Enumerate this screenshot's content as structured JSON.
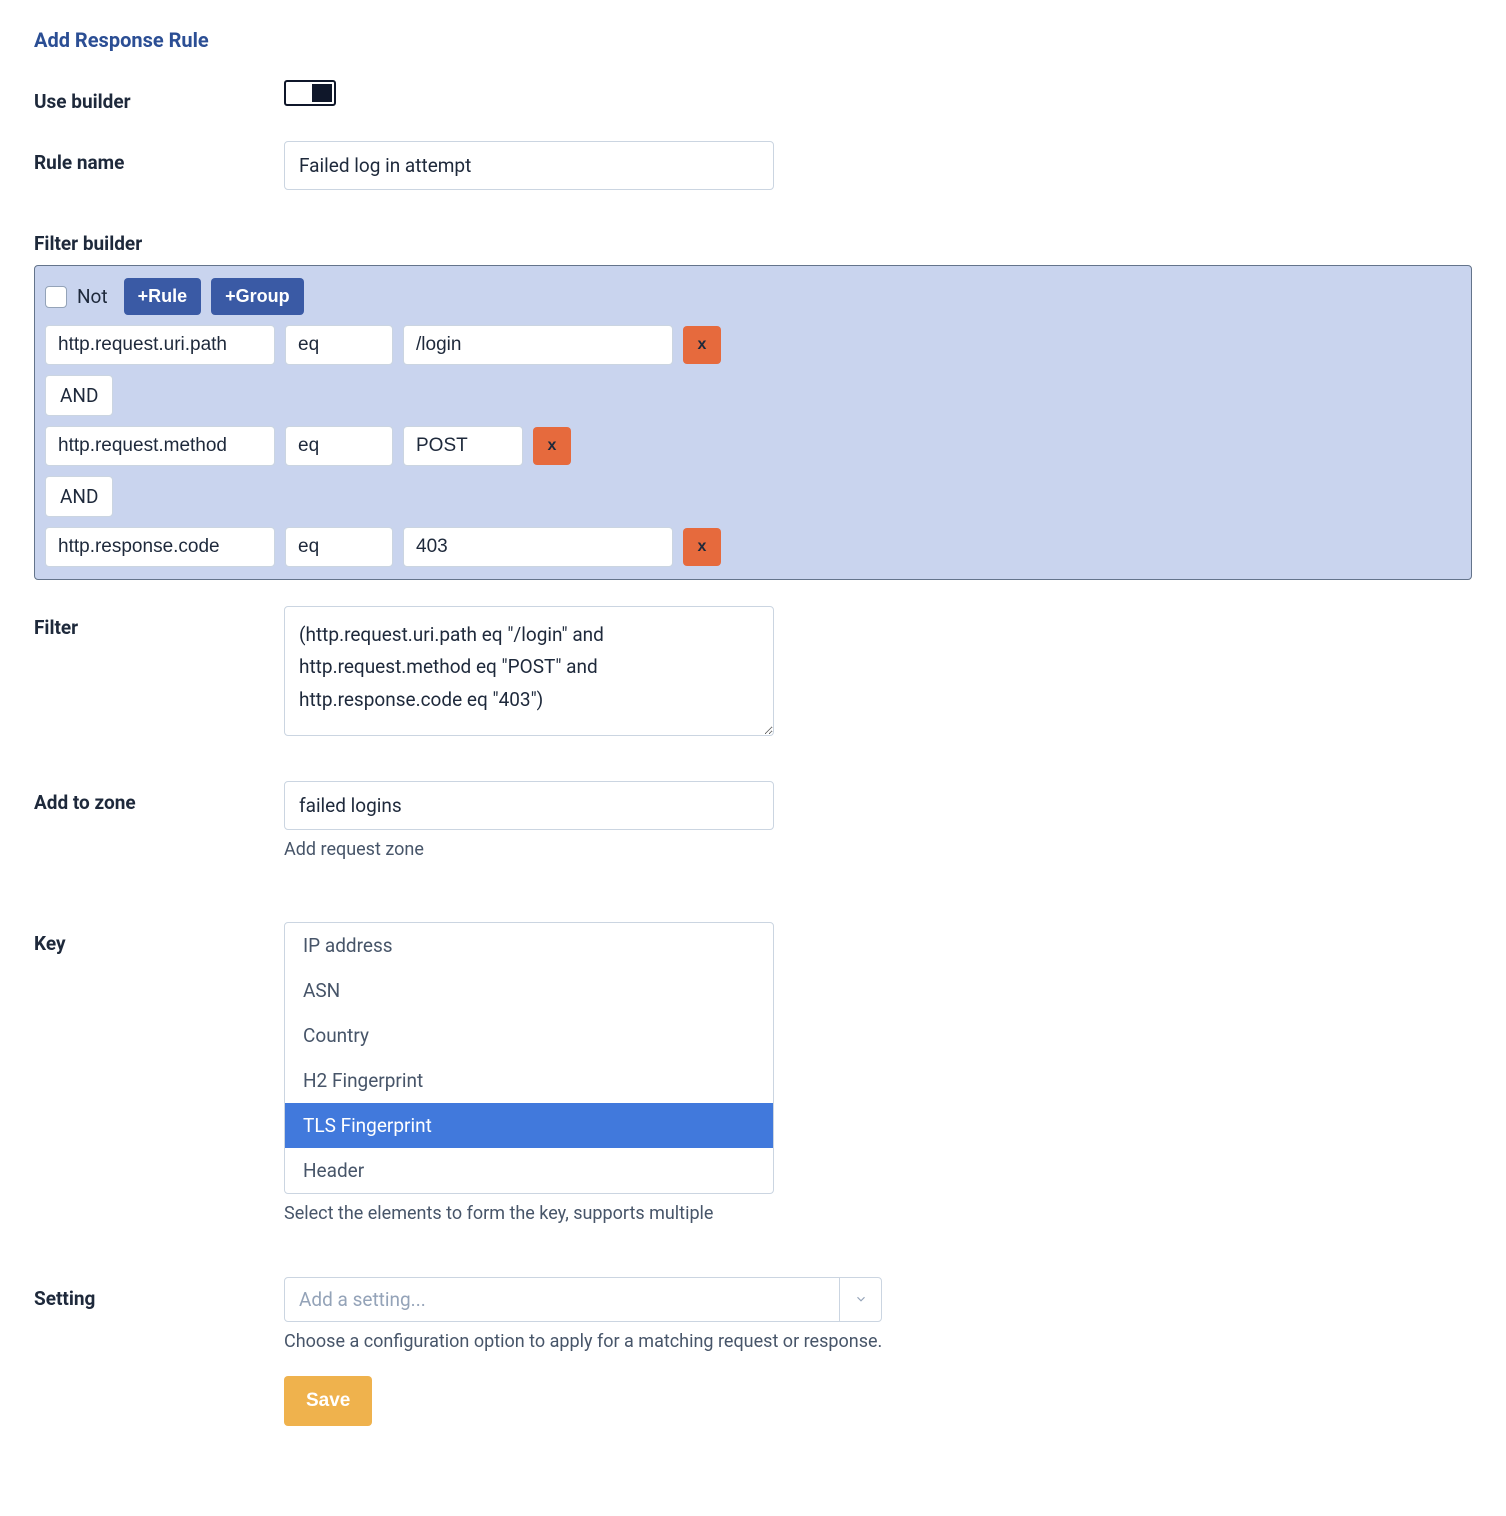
{
  "page_title": "Add Response Rule",
  "labels": {
    "use_builder": "Use builder",
    "rule_name": "Rule name",
    "filter_builder": "Filter builder",
    "filter": "Filter",
    "add_to_zone": "Add to zone",
    "key": "Key",
    "setting": "Setting"
  },
  "rule_name_value": "Failed log in attempt",
  "filter_builder": {
    "not_label": "Not",
    "add_rule_label": "+Rule",
    "add_group_label": "+Group",
    "rules": [
      {
        "field": "http.request.uri.path",
        "op": "eq",
        "value": "/login"
      },
      {
        "field": "http.request.method",
        "op": "eq",
        "value": "POST"
      },
      {
        "field": "http.response.code",
        "op": "eq",
        "value": "403"
      }
    ],
    "conjunction": "AND",
    "delete_label": "x"
  },
  "filter_text": "(http.request.uri.path eq \"/login\" and http.request.method eq \"POST\" and http.response.code eq \"403\")",
  "add_to_zone": {
    "value": "failed logins",
    "helper": "Add request zone"
  },
  "key": {
    "options": [
      "IP address",
      "ASN",
      "Country",
      "H2 Fingerprint",
      "TLS Fingerprint",
      "Header"
    ],
    "selected": "TLS Fingerprint",
    "helper": "Select the elements to form the key, supports multiple"
  },
  "setting": {
    "placeholder": "Add a setting...",
    "helper": "Choose a configuration option to apply for a matching request or response."
  },
  "save_label": "Save"
}
